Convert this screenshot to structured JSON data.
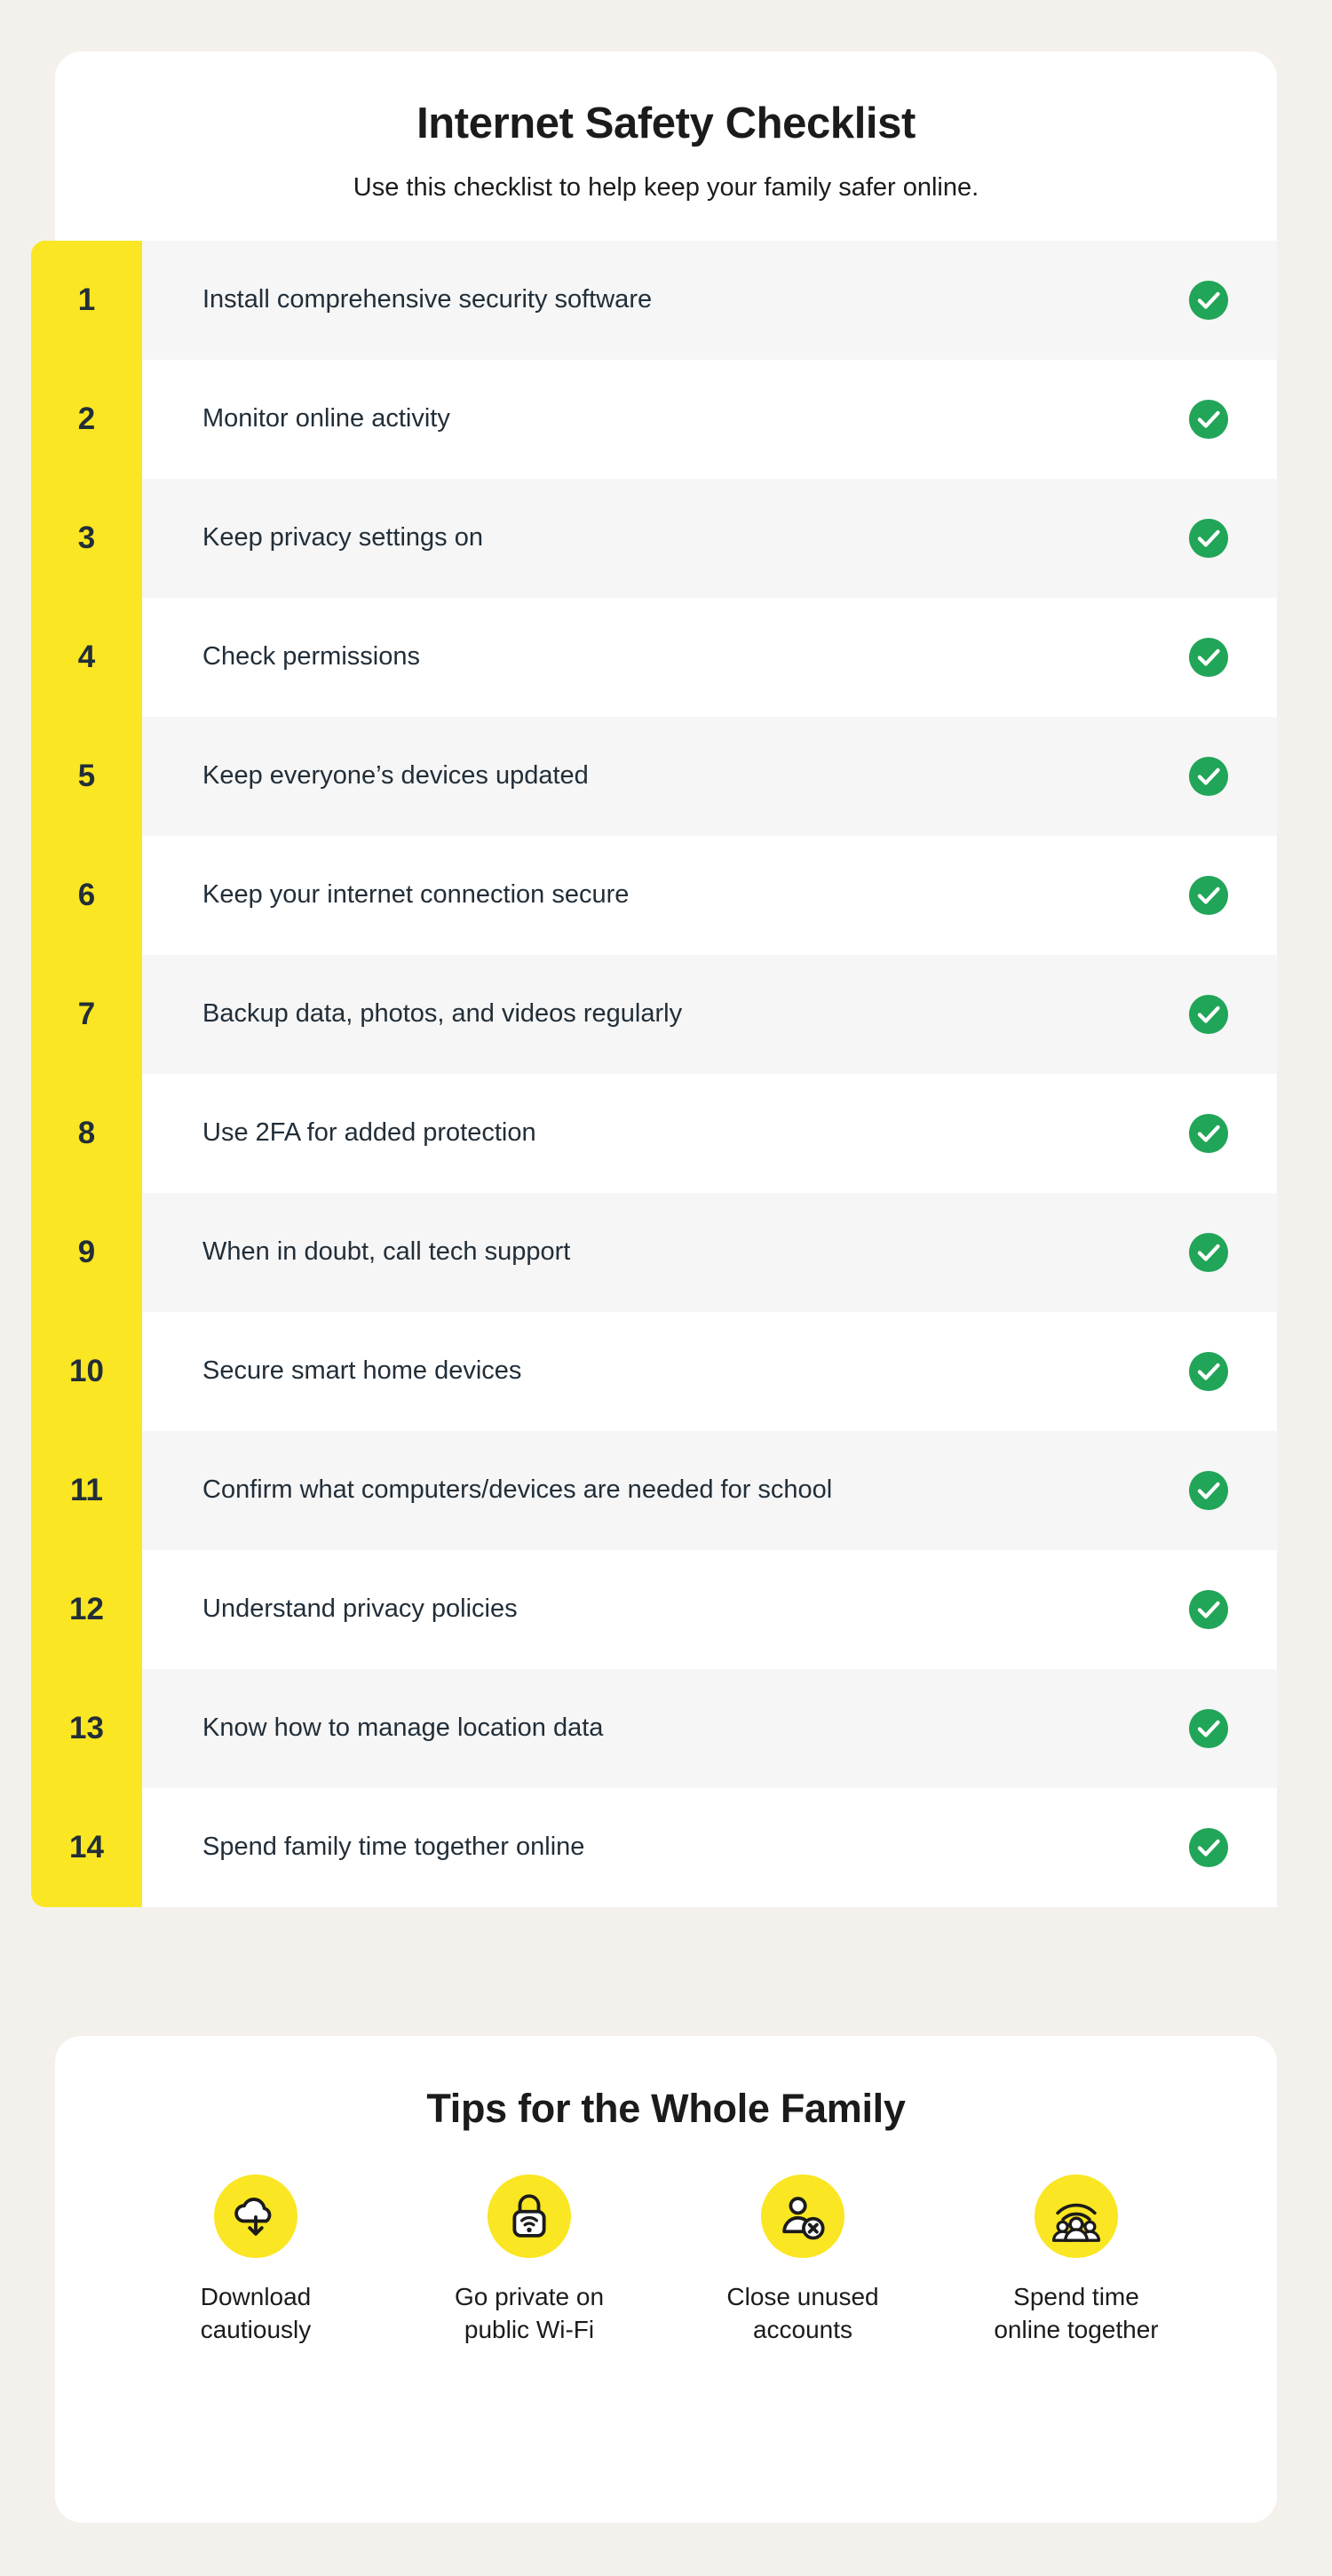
{
  "header": {
    "title": "Internet Safety Checklist",
    "subtitle": "Use this checklist to help keep your family safer online."
  },
  "colors": {
    "page_background": "#F4F1EC",
    "card_background": "#FFFFFF",
    "row_alt_background": "#F6F6F6",
    "number_block_yellow": "#FAE622",
    "check_green": "#21A558",
    "text_dark": "#222E38",
    "heading_dark": "#1B1B1B"
  },
  "checklist": {
    "items": [
      {
        "number": "1",
        "label": "Install comprehensive security software",
        "status_icon": "check-circle-icon",
        "checked": true
      },
      {
        "number": "2",
        "label": "Monitor online activity",
        "status_icon": "check-circle-icon",
        "checked": true
      },
      {
        "number": "3",
        "label": "Keep privacy settings on",
        "status_icon": "check-circle-icon",
        "checked": true
      },
      {
        "number": "4",
        "label": "Check permissions",
        "status_icon": "check-circle-icon",
        "checked": true
      },
      {
        "number": "5",
        "label": "Keep everyone’s devices updated",
        "status_icon": "check-circle-icon",
        "checked": true
      },
      {
        "number": "6",
        "label": "Keep your internet connection secure",
        "status_icon": "check-circle-icon",
        "checked": true
      },
      {
        "number": "7",
        "label": "Backup data, photos, and videos regularly",
        "status_icon": "check-circle-icon",
        "checked": true
      },
      {
        "number": "8",
        "label": "Use 2FA for added protection",
        "status_icon": "check-circle-icon",
        "checked": true
      },
      {
        "number": "9",
        "label": "When in doubt, call tech support",
        "status_icon": "check-circle-icon",
        "checked": true
      },
      {
        "number": "10",
        "label": "Secure smart home devices",
        "status_icon": "check-circle-icon",
        "checked": true
      },
      {
        "number": "11",
        "label": "Confirm what computers/devices are needed for school",
        "status_icon": "check-circle-icon",
        "checked": true
      },
      {
        "number": "12",
        "label": "Understand privacy policies",
        "status_icon": "check-circle-icon",
        "checked": true
      },
      {
        "number": "13",
        "label": "Know how to manage location data",
        "status_icon": "check-circle-icon",
        "checked": true
      },
      {
        "number": "14",
        "label": "Spend family time together online",
        "status_icon": "check-circle-icon",
        "checked": true
      }
    ]
  },
  "tips": {
    "title": "Tips for the Whole Family",
    "items": [
      {
        "icon": "cloud-download-icon",
        "line1": "Download",
        "line2": "cautiously"
      },
      {
        "icon": "lock-wifi-icon",
        "line1": "Go private on",
        "line2": "public Wi-Fi"
      },
      {
        "icon": "user-remove-icon",
        "line1": "Close unused",
        "line2": "accounts"
      },
      {
        "icon": "people-wifi-icon",
        "line1": "Spend time",
        "line2": "online together"
      }
    ]
  }
}
